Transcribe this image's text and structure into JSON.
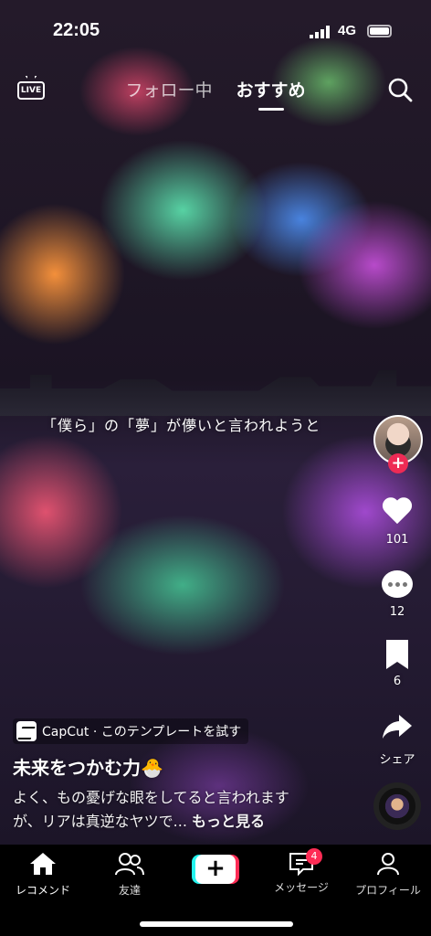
{
  "status_bar": {
    "time": "22:05",
    "network": "4G"
  },
  "top_nav": {
    "live_label": "LIVE",
    "tabs": [
      {
        "label": "フォロー中",
        "active": false
      },
      {
        "label": "おすすめ",
        "active": true
      }
    ]
  },
  "video": {
    "overlay_text": "「僕ら」の「夢」が儚いと言われようと"
  },
  "actions": {
    "likes": "101",
    "comments": "12",
    "saves": "6",
    "share_label": "シェア"
  },
  "info": {
    "capcut_label": "CapCut · このテンプレートを試す",
    "sound_title": "未来をつかむ力🐣",
    "description": "よく、もの憂げな眼をしてると言われますが、リアは真逆なヤツで...",
    "more_label": "もっと見る"
  },
  "bottom_nav": {
    "items": [
      {
        "label": "レコメンド",
        "icon": "home-icon",
        "active": true
      },
      {
        "label": "友達",
        "icon": "friends-icon",
        "active": false
      },
      {
        "label": "+",
        "icon": "create-icon",
        "active": false
      },
      {
        "label": "メッセージ",
        "icon": "inbox-icon",
        "active": false,
        "badge": "4"
      },
      {
        "label": "プロフィール",
        "icon": "profile-icon",
        "active": false
      }
    ]
  },
  "colors": {
    "accent_red": "#fe2c55",
    "accent_cyan": "#25f4ee"
  }
}
